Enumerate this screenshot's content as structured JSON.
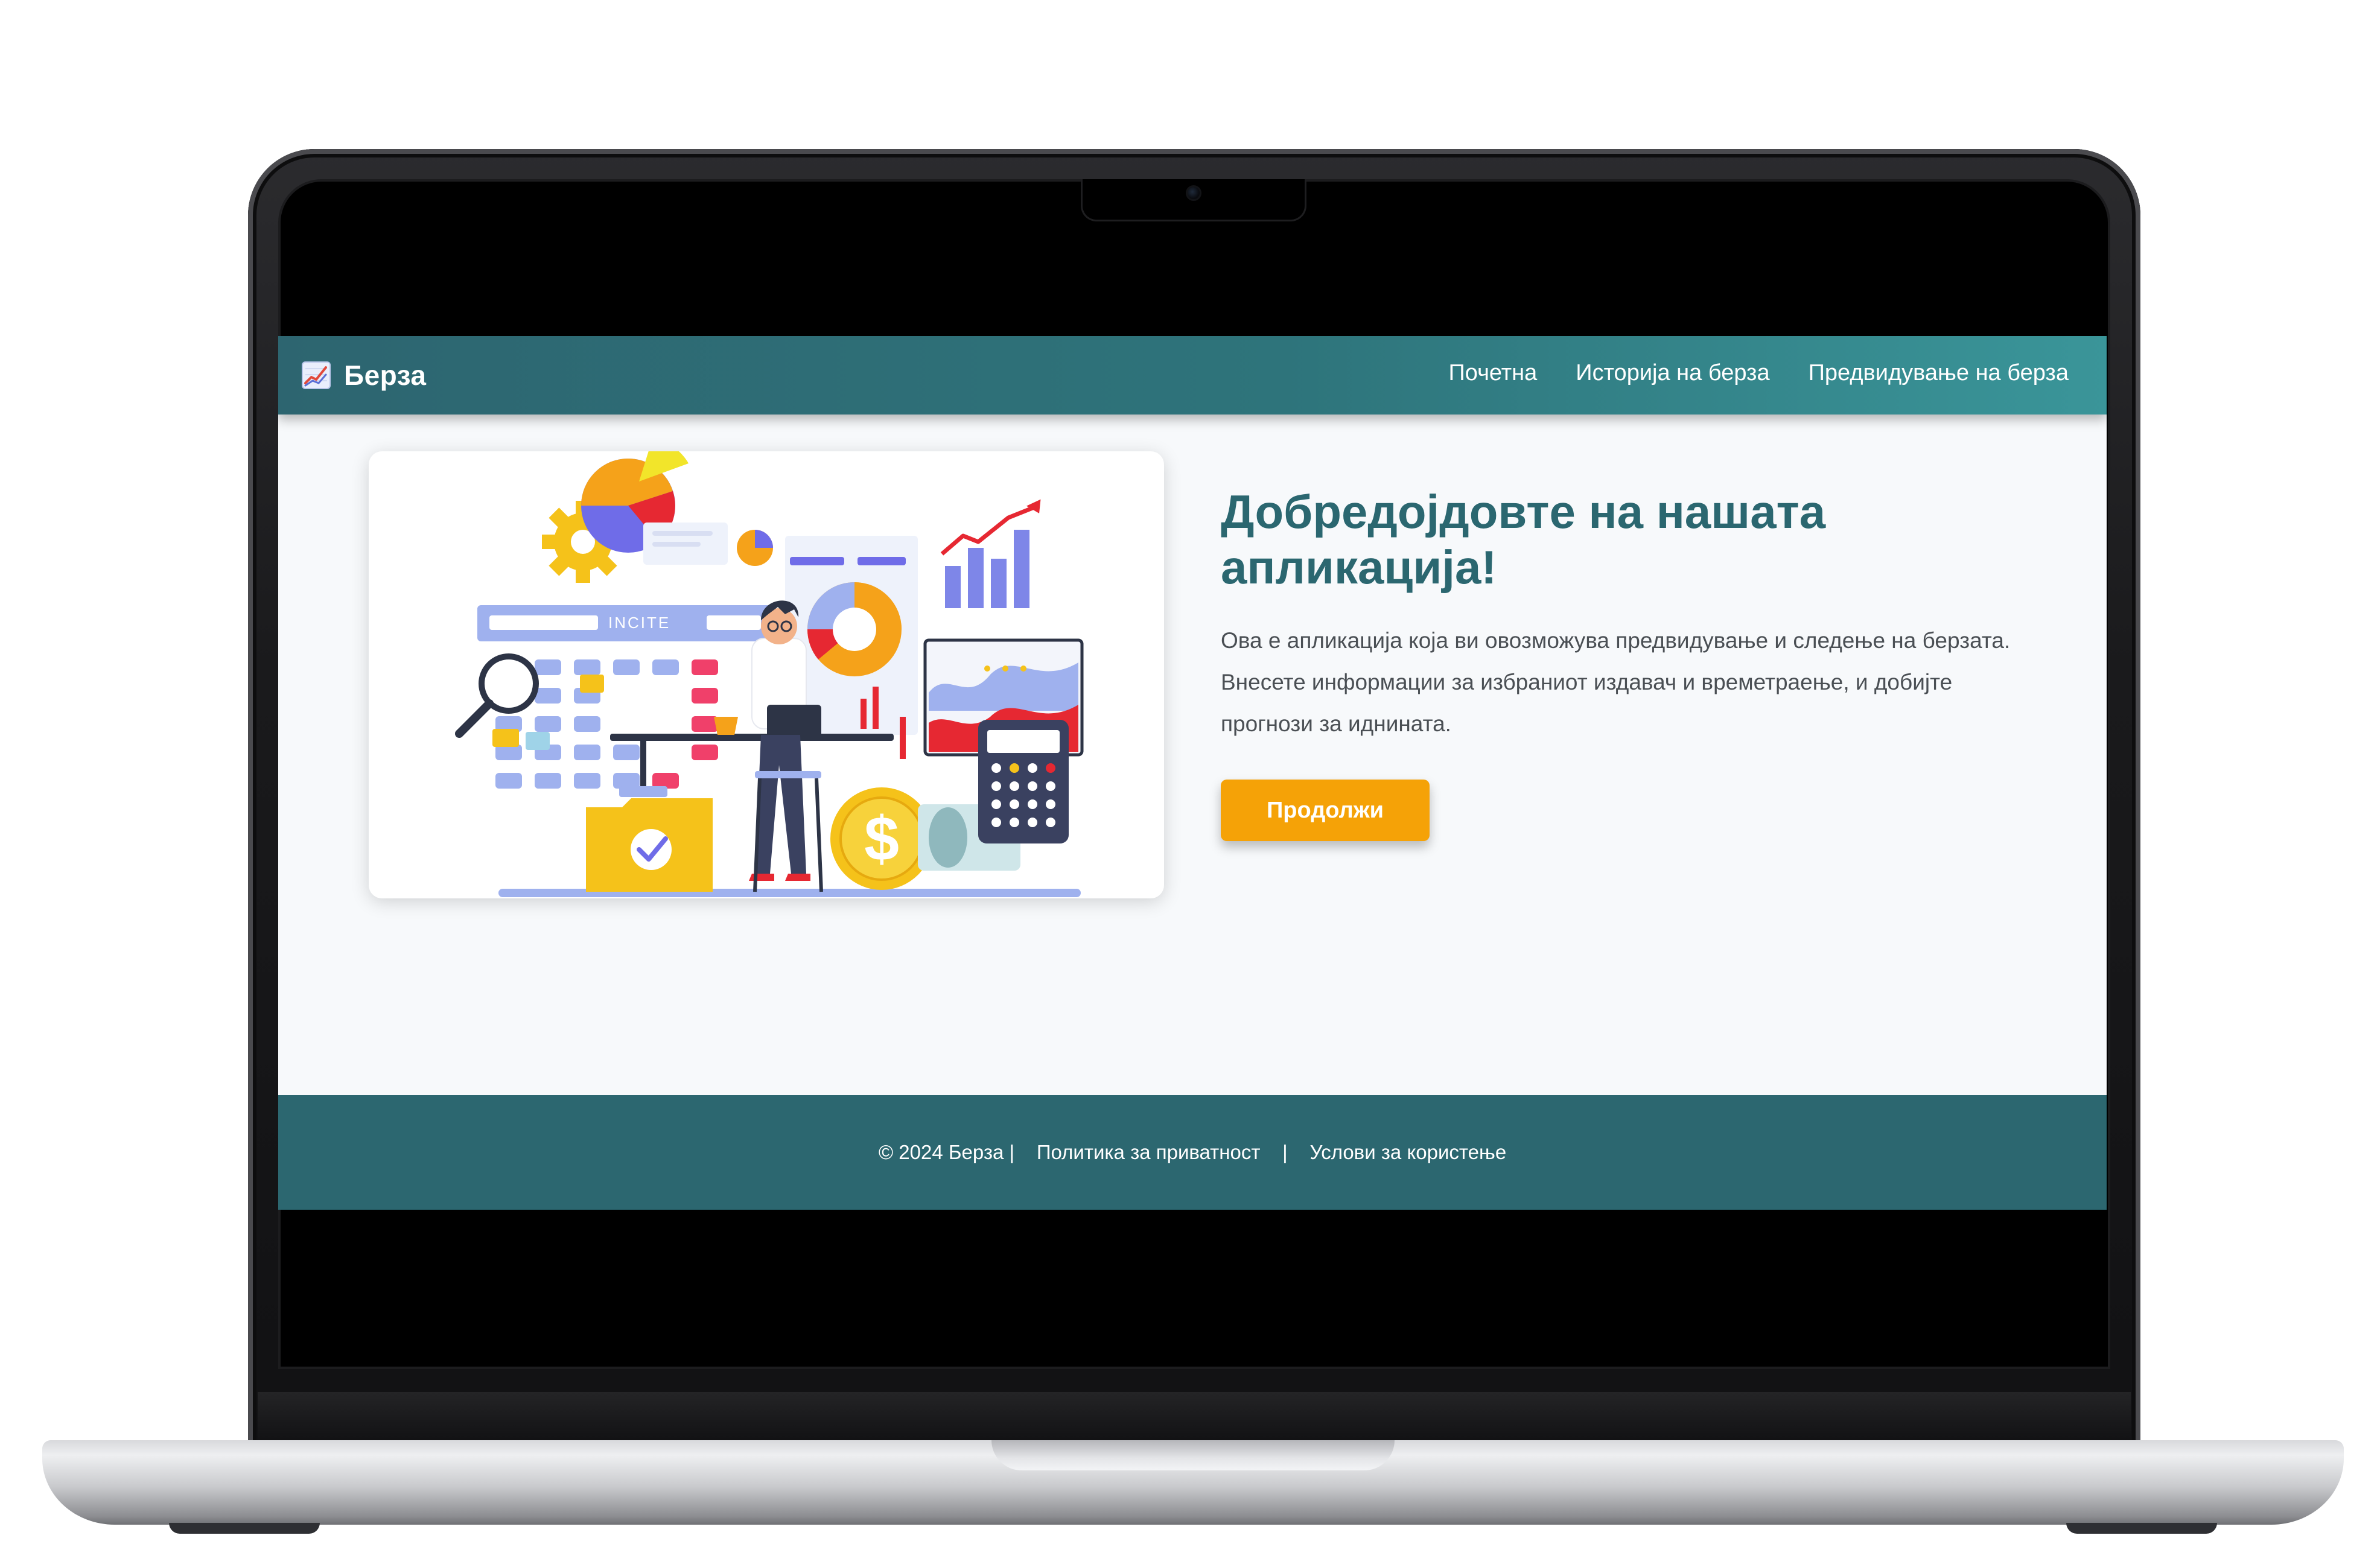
{
  "brand": {
    "name": "Берза",
    "icon": "chart-up-icon"
  },
  "nav": {
    "items": [
      {
        "label": "Почетна"
      },
      {
        "label": "Историја на берза"
      },
      {
        "label": "Предвидување на берза"
      }
    ]
  },
  "hero": {
    "illustration_label": "INCITE",
    "title": "Добредојдовте на нашата апликација!",
    "description": "Ова е апликација која ви овозможува предвидување и следење на берзата. Внесете информации за избраниот издавач и времетраење, и добијте прогнози за иднината.",
    "button_label": "Продолжи"
  },
  "footer": {
    "copyright": "© 2024 Берза",
    "separator": "|",
    "privacy_label": "Политика за приватност",
    "terms_label": "Услови за користење"
  },
  "colors": {
    "navbar": "#2e747b",
    "title": "#2b6770",
    "button": "#f5a207",
    "footer": "#2c6770",
    "screen_bg": "#f7f9fb"
  }
}
